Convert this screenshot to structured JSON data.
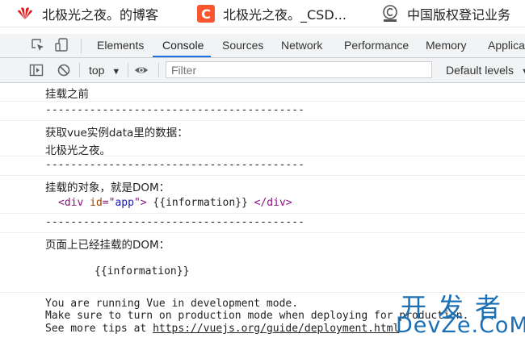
{
  "bookmarks": [
    {
      "label": "北极光之夜。的博客",
      "icon": "huawei-logo-icon"
    },
    {
      "label": "北极光之夜。_CSD...",
      "icon": "csdn-logo-icon"
    },
    {
      "label": "中国版权登记业务",
      "icon": "cpcc-logo-icon"
    }
  ],
  "devtools": {
    "tabs": [
      "Elements",
      "Console",
      "Sources",
      "Network",
      "Performance",
      "Memory",
      "Applicat"
    ],
    "active_tab": "Console"
  },
  "console_toolbar": {
    "context": "top",
    "filter_placeholder": "Filter",
    "levels": "Default levels"
  },
  "console_messages": {
    "m1": "挂载之前",
    "m2": "-----------------------------------------",
    "m3": "获取vue实例data里的数据：",
    "m4": "北极光之夜。",
    "m5": "-----------------------------------------",
    "m6": "挂载的对象，就是DOM：",
    "m7": {
      "open_tag": "<div",
      "attr_name": "id",
      "attr_eq": "=\"",
      "attr_value": "app",
      "attr_close": "\">",
      "inner": " {{information}} ",
      "close_tag": "</div>"
    },
    "m8": "-----------------------------------------",
    "m9": "页面上已经挂载的DOM：",
    "m10": "{{information}}",
    "footer": {
      "line1": "You are running Vue in development mode.",
      "line2": "Make sure to turn on production mode when deploying for production.",
      "line3_prefix": "See more tips at ",
      "line3_link": "https://vuejs.org/guide/deployment.html"
    }
  },
  "watermark": {
    "top": "开发者",
    "bottom": "DevZe.CoM"
  },
  "colors": {
    "accent": "#1a73e8",
    "tag": "#881280",
    "attr_name": "#994500",
    "attr_value": "#1a1aa6",
    "watermark": "#1b6fb5"
  }
}
